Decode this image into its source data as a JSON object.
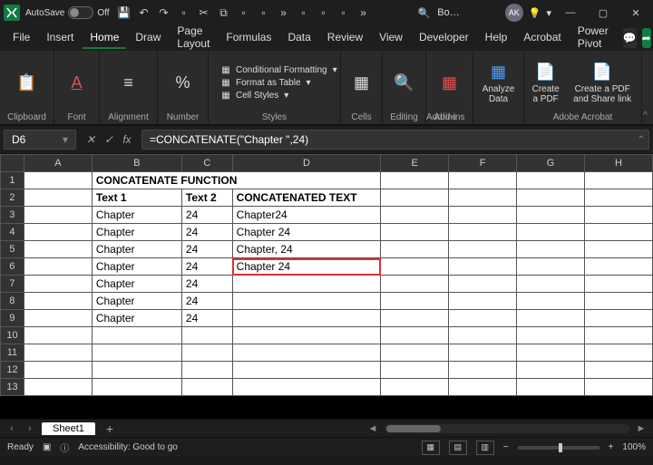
{
  "titlebar": {
    "autosave_label": "AutoSave",
    "autosave_state": "Off",
    "doc_title": "Bo…",
    "avatar": "AK"
  },
  "menus": [
    "File",
    "Insert",
    "Home",
    "Draw",
    "Page Layout",
    "Formulas",
    "Data",
    "Review",
    "View",
    "Developer",
    "Help",
    "Acrobat",
    "Power Pivot"
  ],
  "active_menu": "Home",
  "ribbon": {
    "clipboard": "Clipboard",
    "font": "Font",
    "alignment": "Alignment",
    "number": "Number",
    "cond_fmt": "Conditional Formatting",
    "fmt_table": "Format as Table",
    "cell_styles": "Cell Styles",
    "styles": "Styles",
    "cells": "Cells",
    "editing": "Editing",
    "addins": "Add-ins",
    "addins_group": "Add-ins",
    "analyze": "Analyze Data",
    "create_pdf": "Create a PDF",
    "create_share": "Create a PDF and Share link",
    "acro_group": "Adobe Acrobat"
  },
  "namebox": "D6",
  "formula": "=CONCATENATE(\"Chapter \",24)",
  "columns": [
    "A",
    "B",
    "C",
    "D",
    "E",
    "F",
    "G",
    "H"
  ],
  "rows": [
    "1",
    "2",
    "3",
    "4",
    "5",
    "6",
    "7",
    "8",
    "9",
    "10",
    "11",
    "12"
  ],
  "table": {
    "title": "CONCATENATE FUNCTION",
    "h1": "Text 1",
    "h2": "Text 2",
    "h3": "CONCATENATED TEXT",
    "b": [
      "Chapter",
      "Chapter",
      "Chapter",
      "Chapter",
      "Chapter",
      "Chapter",
      "Chapter"
    ],
    "c": [
      "24",
      "24",
      "24",
      "24",
      "24",
      "24",
      "24"
    ],
    "d": [
      "Chapter24",
      "Chapter 24",
      "Chapter, 24",
      "Chapter 24",
      "",
      "",
      ""
    ]
  },
  "sheet": {
    "name": "Sheet1"
  },
  "status": {
    "ready": "Ready",
    "access": "Accessibility: Good to go",
    "zoom": "100%"
  }
}
